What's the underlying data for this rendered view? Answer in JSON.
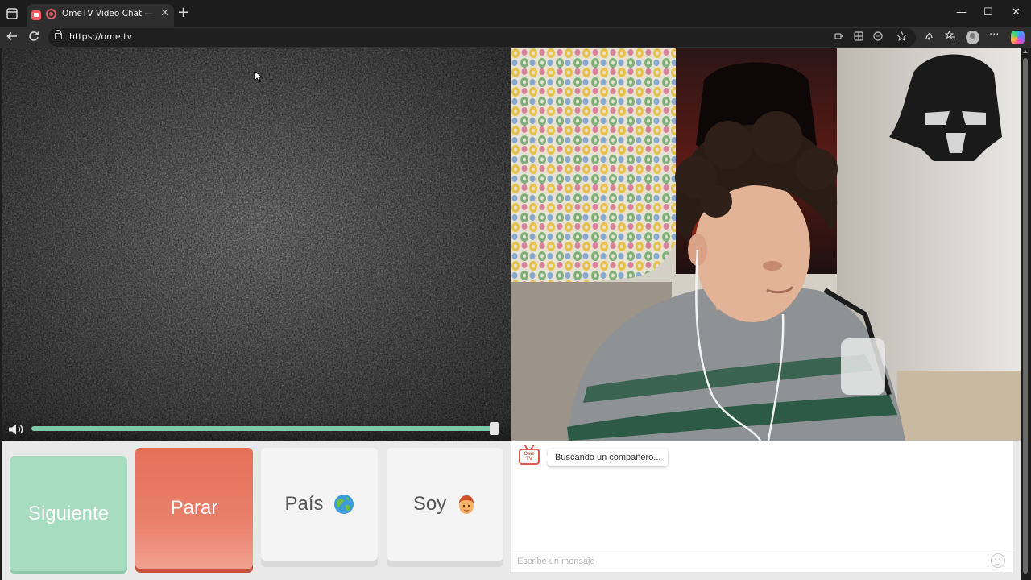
{
  "browser": {
    "tab": {
      "title": "OmeTV Video Chat — Omegle",
      "close_glyph": "✕"
    },
    "new_tab_glyph": "+",
    "address": {
      "url": "https://ome.tv"
    },
    "window_controls": {
      "minimize": "—",
      "maximize": "☐",
      "close": "✕"
    },
    "icons": [
      "tab-actions-icon",
      "back-icon",
      "refresh-icon",
      "lock-icon",
      "video-icon",
      "app-icon",
      "extensions-icon",
      "favorite-star-icon",
      "performance-icon",
      "favorites-icon",
      "profile-avatar-icon",
      "more-icon",
      "copilot-icon"
    ]
  },
  "page": {
    "buttons": {
      "next": "Siguiente",
      "stop": "Parar",
      "country": "País",
      "gender": "Soy"
    },
    "volume": {
      "level": 0.99
    },
    "chat": {
      "logo_text": "Ome TV",
      "status_message": "Buscando un compañero...",
      "input_placeholder": "Escribe un mensaje"
    },
    "colors": {
      "next_button": "#a7dcc0",
      "stop_button": "#e5705a",
      "volume_track": "#7ec8a8",
      "logo_accent": "#e0594e"
    }
  }
}
